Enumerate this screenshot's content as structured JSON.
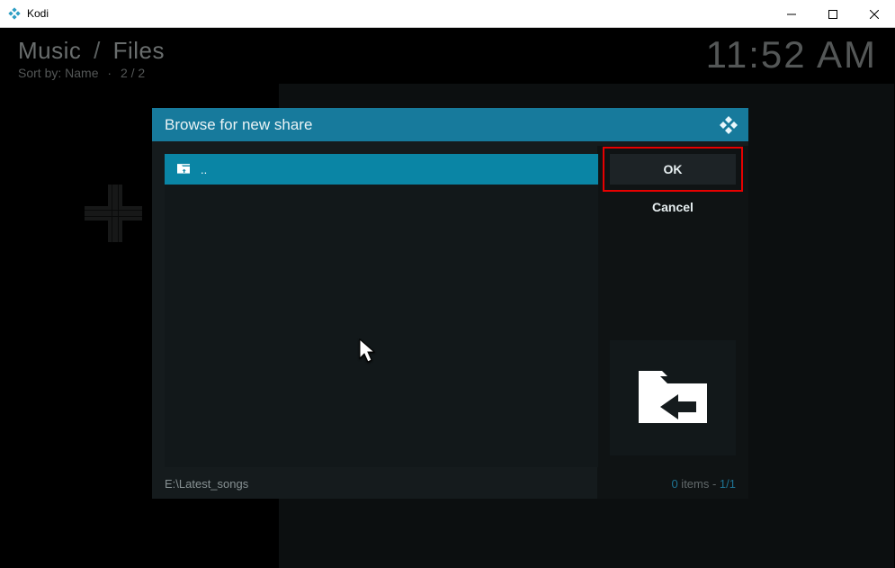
{
  "window": {
    "title": "Kodi"
  },
  "breadcrumb": {
    "segment1": "Music",
    "segment2": "Files",
    "sep": "/"
  },
  "sortline": {
    "label": "Sort by:",
    "field": "Name",
    "counter": "2 / 2"
  },
  "clock": "11:52 AM",
  "dialog": {
    "title": "Browse for new share",
    "list": {
      "items": [
        {
          "label": "..",
          "icon": "folder-up"
        }
      ]
    },
    "buttons": {
      "ok": "OK",
      "cancel": "Cancel"
    },
    "path": "E:\\Latest_songs",
    "footer": {
      "count_num": "0",
      "count_word": " items - ",
      "position": "1/1"
    }
  }
}
